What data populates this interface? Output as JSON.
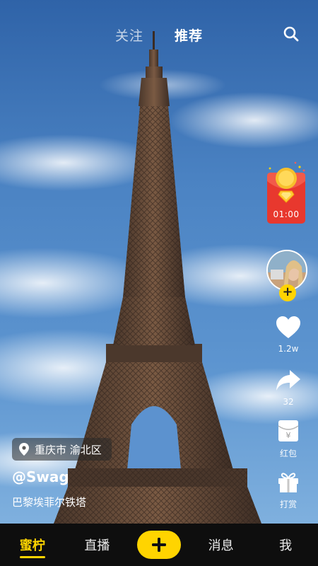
{
  "top_tabs": {
    "follow": "关注",
    "recommend": "推荐"
  },
  "red_packet": {
    "timer": "01:00"
  },
  "actions": {
    "like_count": "1.2w",
    "share_count": "32",
    "hongbao_label": "红包",
    "gift_label": "打赏"
  },
  "post": {
    "location": "重庆市 渝北区",
    "author": "@Swag",
    "caption": "巴黎埃菲尔铁塔"
  },
  "bottom_nav": {
    "home": "蜜柠",
    "live": "直播",
    "messages": "消息",
    "me": "我"
  },
  "colors": {
    "accent": "#ffd400",
    "red_packet": "#e8382e",
    "nav_bg": "#0e0e0e"
  }
}
